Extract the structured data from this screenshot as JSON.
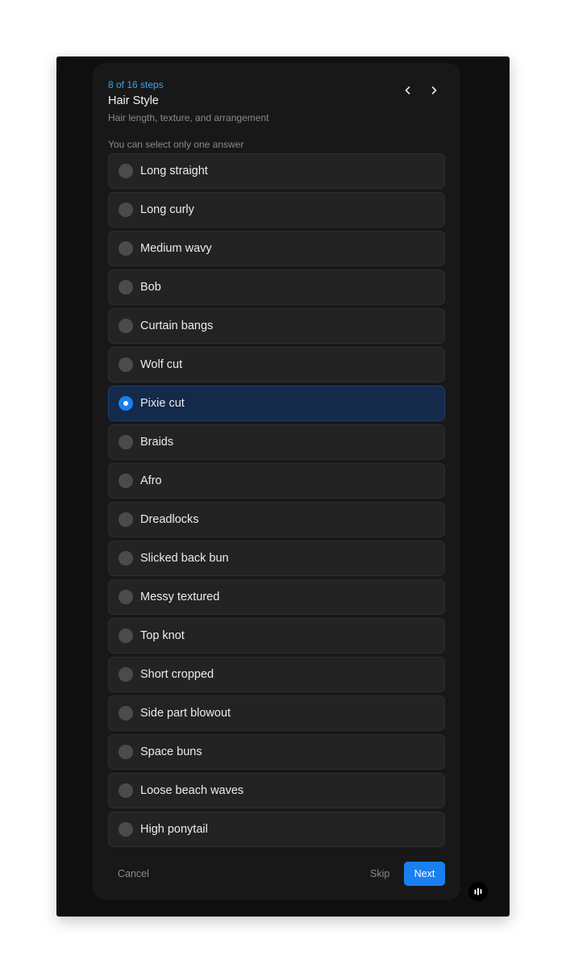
{
  "header": {
    "step_count": "8 of 16 steps",
    "title": "Hair Style",
    "subtitle": "Hair length, texture, and arrangement"
  },
  "navigation": {
    "prev_icon": "chevron-left-icon",
    "next_icon": "chevron-right-icon"
  },
  "question": {
    "instruction": "You can select only one answer",
    "selected_index": 6,
    "options": [
      {
        "label": "Long straight"
      },
      {
        "label": "Long curly"
      },
      {
        "label": "Medium wavy"
      },
      {
        "label": "Bob"
      },
      {
        "label": "Curtain bangs"
      },
      {
        "label": "Wolf cut"
      },
      {
        "label": "Pixie cut"
      },
      {
        "label": "Braids"
      },
      {
        "label": "Afro"
      },
      {
        "label": "Dreadlocks"
      },
      {
        "label": "Slicked back bun"
      },
      {
        "label": "Messy textured"
      },
      {
        "label": "Top knot"
      },
      {
        "label": "Short cropped"
      },
      {
        "label": "Side part blowout"
      },
      {
        "label": "Space buns"
      },
      {
        "label": "Loose beach waves"
      },
      {
        "label": "High ponytail"
      }
    ]
  },
  "footer": {
    "cancel_label": "Cancel",
    "skip_label": "Skip",
    "next_label": "Next"
  },
  "widget": {
    "icon": "audio-bars-icon"
  },
  "colors": {
    "accent": "#1a7ff0",
    "step_count": "#3ea4e6",
    "selected_background": "#15294a",
    "option_background": "#232323",
    "card_background": "#181818",
    "window_background": "#0f0f0f"
  }
}
